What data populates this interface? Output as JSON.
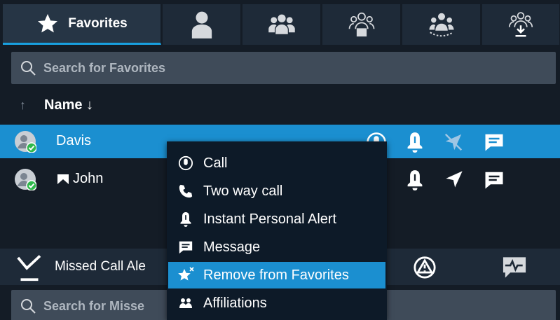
{
  "tabs": {
    "favorites_label": "Favorites",
    "icons": [
      "star-icon",
      "person-icon",
      "group-icon",
      "dispatch-group-icon",
      "broadcast-group-icon",
      "download-group-icon"
    ]
  },
  "search": {
    "placeholder": "Search for Favorites"
  },
  "list_header": {
    "sort_up": "↑",
    "name_column": "Name ↓"
  },
  "contacts": [
    {
      "name": "Davis",
      "status": "online",
      "selected": true
    },
    {
      "name": "John",
      "status": "online",
      "selected": false
    }
  ],
  "missed_panel": {
    "label": "Missed Call Ale",
    "search_placeholder": "Search for Misse"
  },
  "context_menu": {
    "items": [
      {
        "label": "Call",
        "icon": "call-icon"
      },
      {
        "label": "Two way call",
        "icon": "phone-icon"
      },
      {
        "label": "Instant Personal Alert",
        "icon": "bell-icon"
      },
      {
        "label": "Message",
        "icon": "message-icon"
      },
      {
        "label": "Remove from Favorites",
        "icon": "star-remove-icon",
        "highlighted": true
      },
      {
        "label": "Affiliations",
        "icon": "affiliations-icon"
      }
    ]
  },
  "colors": {
    "accent": "#1b8fd0",
    "background": "#141c26",
    "panel": "#1e2a38",
    "online": "#2eb84b"
  }
}
